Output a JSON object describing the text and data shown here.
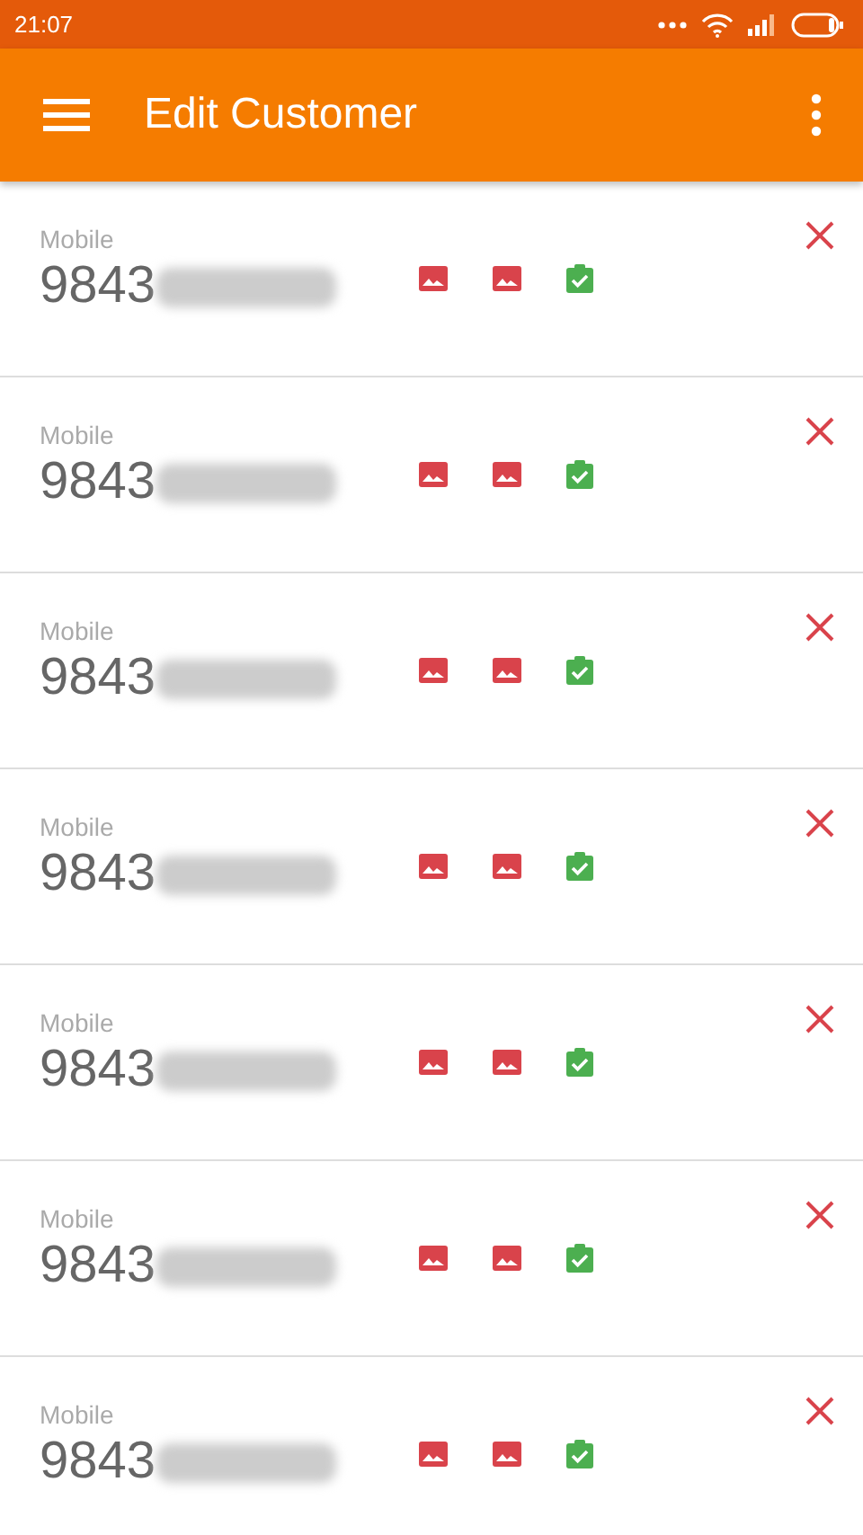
{
  "status_bar": {
    "time": "21:07"
  },
  "app_bar": {
    "title": "Edit Customer"
  },
  "contacts": [
    {
      "label": "Mobile",
      "number": "9843"
    },
    {
      "label": "Mobile",
      "number": "9843"
    },
    {
      "label": "Mobile",
      "number": "9843"
    },
    {
      "label": "Mobile",
      "number": "9843"
    },
    {
      "label": "Mobile",
      "number": "9843"
    },
    {
      "label": "Mobile",
      "number": "9843"
    },
    {
      "label": "Mobile",
      "number": "9843"
    }
  ]
}
